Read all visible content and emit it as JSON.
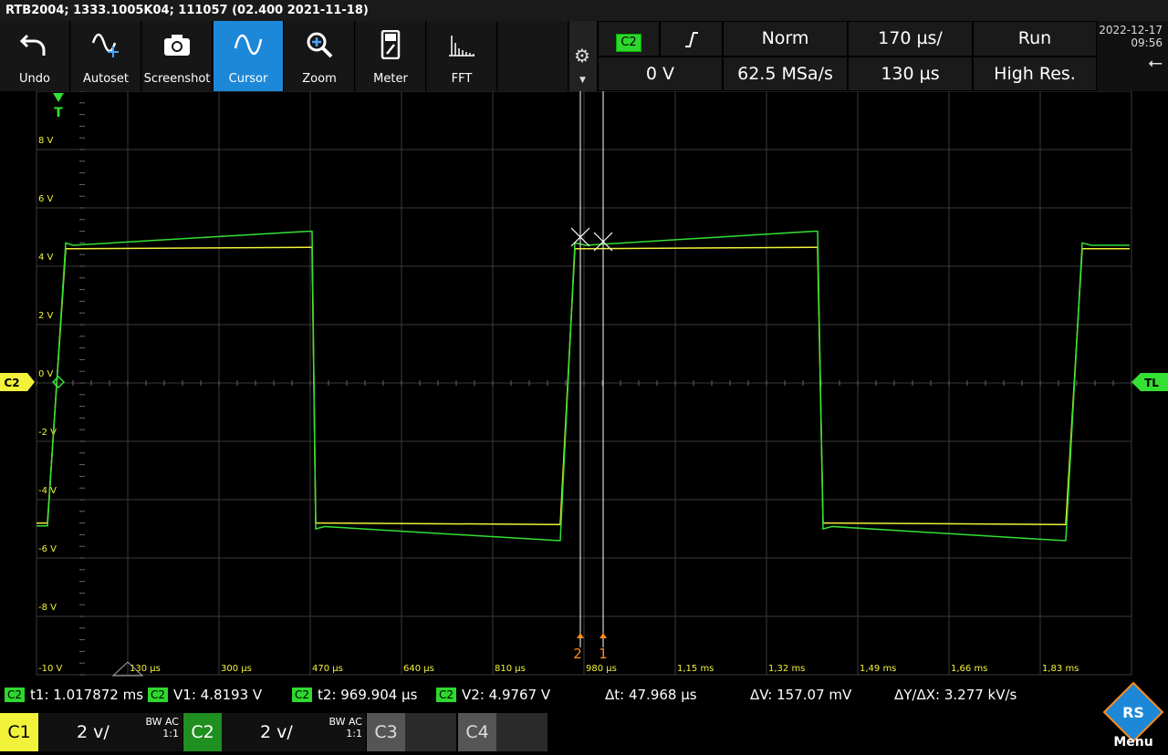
{
  "title_bar": "RTB2004; 1333.1005K04; 111057 (02.400 2021-11-18)",
  "toolbar": [
    {
      "label": "Undo",
      "icon": "undo-icon"
    },
    {
      "label": "Autoset",
      "icon": "autoset-icon"
    },
    {
      "label": "Screenshot",
      "icon": "camera-icon"
    },
    {
      "label": "Cursor",
      "icon": "cursor-wave-icon",
      "active": true
    },
    {
      "label": "Zoom",
      "icon": "zoom-icon"
    },
    {
      "label": "Meter",
      "icon": "meter-icon"
    },
    {
      "label": "FFT",
      "icon": "fft-icon"
    }
  ],
  "trigger": {
    "source": "C2",
    "level": "0 V",
    "mode": "Norm",
    "sample_rate": "62.5 MSa/s",
    "time_scale": "170 µs/",
    "position": "130 µs",
    "run": "Run",
    "acq_mode": "High Res."
  },
  "datetime": {
    "date": "2022-12-17",
    "time": "09:56"
  },
  "plot": {
    "trigger_marker": "T",
    "channel_marker": "C2",
    "trigger_level_marker": "TL",
    "y_labels": [
      "8 V",
      "6 V",
      "4 V",
      "2 V",
      "0 V",
      "-2 V",
      "-4 V",
      "-6 V",
      "-8 V",
      "-10 V"
    ],
    "x_labels": [
      "130 µs",
      "300 µs",
      "470 µs",
      "640 µs",
      "810 µs",
      "980 µs",
      "1,15 ms",
      "1,32 ms",
      "1,49 ms",
      "1,66 ms",
      "1,83 ms"
    ],
    "cursor_labels": [
      "2",
      "1"
    ],
    "colors": {
      "ch1": "#f2f23a",
      "ch2": "#33e033",
      "grid": "#3a3a3a",
      "cursor": "#ffffff",
      "cursor_marker": "#ff8c1a"
    }
  },
  "measurements": {
    "channel": "C2",
    "t1": "t1: 1.017872 ms",
    "v1": "V1: 4.8193 V",
    "t2": "t2: 969.904 µs",
    "v2": "V2: 4.9767 V",
    "dt": "Δt: 47.968 µs",
    "dv": "ΔV: 157.07 mV",
    "dydx": "ΔY/ΔX: 3.277 kV/s"
  },
  "channels": [
    {
      "name": "C1",
      "scale": "2 v/",
      "coupling": "BW AC",
      "ratio": "1:1",
      "color": "#f2f23a"
    },
    {
      "name": "C2",
      "scale": "2 v/",
      "coupling": "BW AC",
      "ratio": "1:1",
      "color": "#1f8f1f"
    },
    {
      "name": "C3"
    },
    {
      "name": "C4"
    }
  ],
  "menu_label": "Menu",
  "logo_text": "RS"
}
